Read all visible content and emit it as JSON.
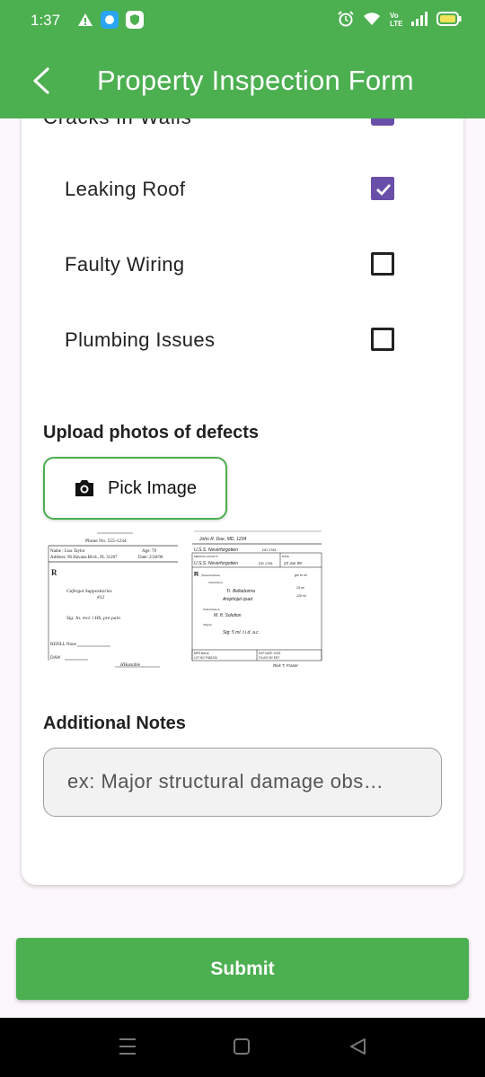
{
  "status_bar": {
    "time": "1:37",
    "left_icons": [
      "warning-icon",
      "chat-bubble-icon",
      "shield-icon"
    ],
    "right_icons": [
      "alarm-icon",
      "wifi-icon",
      "volte-icon",
      "signal-icon",
      "battery-icon"
    ],
    "volte_label": "Vo\nLTE"
  },
  "app_bar": {
    "title": "Property Inspection Form",
    "back_icon": "back-arrow-icon"
  },
  "checklist": {
    "items": [
      {
        "label": "Cracks in Walls",
        "checked": true
      },
      {
        "label": "Leaking Roof",
        "checked": true
      },
      {
        "label": "Faulty Wiring",
        "checked": false
      },
      {
        "label": "Plumbing Issues",
        "checked": false
      }
    ]
  },
  "upload": {
    "heading": "Upload photos of defects",
    "pick_button": "Pick Image",
    "pick_icon": "camera-icon"
  },
  "prescription_1": {
    "phone": "Phone No. 555-1234",
    "name": "Name : Lisa Taylor",
    "age": "Age: 70",
    "address": "Address: 96 Havana Blvd., FL 31207",
    "date": "Date: 2/28/96",
    "rx_symbol": "R",
    "drug": "Cafergot Suppositories",
    "qty": "#12",
    "sig": "Sig: In. rect. i HS, prn pain",
    "refill": "REFILL  None",
    "daw": "DAW",
    "signature": "HHuxtable"
  },
  "prescription_2": {
    "header": "John R. Doe, MD, 1234",
    "hospital": "U.S.S. Neverforgotten",
    "hospital_code": "DD 1781",
    "medical_facility": "MEDICAL FACILITY",
    "date_label": "DATE",
    "hospital_2": "U.S.S. Neverforgotten",
    "hospital_code_2": "DD 1781",
    "date_value": "23 Jun 99",
    "rx_symbol": "R",
    "superscription": "(Superscription)",
    "inscription": "(Inscription)",
    "drug": "Tr. Belladonna",
    "drug_2": "Amphojel qsad",
    "subscription": "(Subscription)",
    "instructions": "M. ft. Solution",
    "signa": "(Signa)",
    "sig": "Sig: 5 ml. t.i.d. a.c.",
    "side_1": "gm or ml",
    "side_2": "15 ml",
    "side_3": "120 ml",
    "mfr": "MFR  Merck",
    "lot": "LOT NO  P4B1234",
    "exp": "EXP DATE  12/22",
    "filled_by": "FILLED BY  ENT",
    "signature": "Rick T. Fraser"
  },
  "notes": {
    "heading": "Additional Notes",
    "placeholder": "ex: Major structural damage obs…"
  },
  "submit": {
    "label": "Submit"
  },
  "nav_bar": {
    "icons": [
      "menu-icon",
      "home-icon",
      "back-triangle-icon"
    ]
  },
  "colors": {
    "primary": "#4caf50",
    "checkbox_checked": "#6a4fa8",
    "background": "#fcf7fb"
  }
}
